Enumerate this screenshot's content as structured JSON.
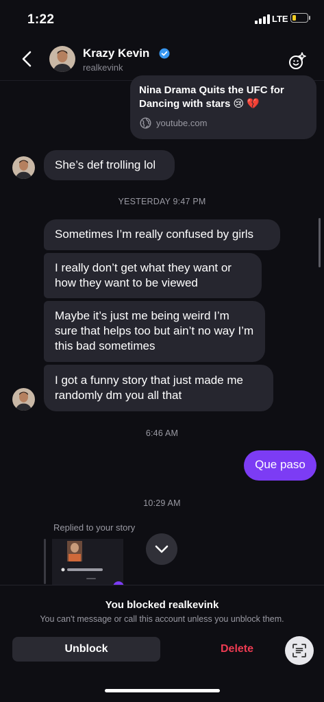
{
  "status_bar": {
    "time": "1:22",
    "network": "LTE",
    "battery_level": 0.25,
    "battery_color": "#f2cd22"
  },
  "header": {
    "name": "Krazy Kevin",
    "handle": "realkevink",
    "verified": true
  },
  "link_preview": {
    "title": "Nina Drama Quits the UFC for Dancing with stars 😢 💔",
    "domain": "youtube.com"
  },
  "messages": {
    "m1": "She’s def trolling lol",
    "ts1": "YESTERDAY 9:47 PM",
    "m2": "Sometimes I’m really confused by girls",
    "m3": "I really don’t get what they want or how they want to be viewed",
    "m4": "Maybe it’s just me being weird I’m sure that helps too but ain’t no way I’m this bad sometimes",
    "m5": "I got a funny story that just made me randomly dm you all that",
    "ts2": "6:46 AM",
    "out1": "Que paso",
    "ts3": "10:29 AM",
    "story_caption": "Replied to your story"
  },
  "blocked": {
    "title": "You blocked realkevink",
    "subtitle": "You can't message or call this account unless you unblock them.",
    "unblock_label": "Unblock",
    "delete_label": "Delete"
  },
  "colors": {
    "accent": "#7c3cf4",
    "bubble": "#26262f",
    "delete": "#ee3b52",
    "verified": "#3897f0"
  }
}
